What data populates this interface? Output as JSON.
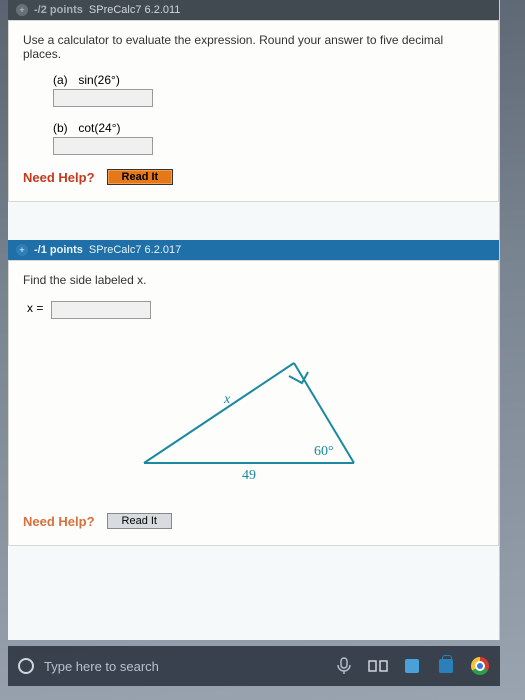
{
  "q1": {
    "header_points": "-/2 points",
    "header_source": "SPreCalc7 6.2.011",
    "prompt": "Use a calculator to evaluate the expression. Round your answer to five decimal places.",
    "part_a_label": "(a)",
    "part_a_expr": "sin(26°)",
    "part_b_label": "(b)",
    "part_b_expr": "cot(24°)",
    "need_help": "Need Help?",
    "read_it": "Read It"
  },
  "q2": {
    "header_points": "-/1 points",
    "header_source": "SPreCalc7 6.2.017",
    "prompt": "Find the side labeled x.",
    "x_label": "x =",
    "tri_x": "x",
    "tri_angle": "60°",
    "tri_base": "49",
    "need_help": "Need Help?",
    "read_it": "Read It"
  },
  "taskbar": {
    "search_placeholder": "Type here to search"
  }
}
